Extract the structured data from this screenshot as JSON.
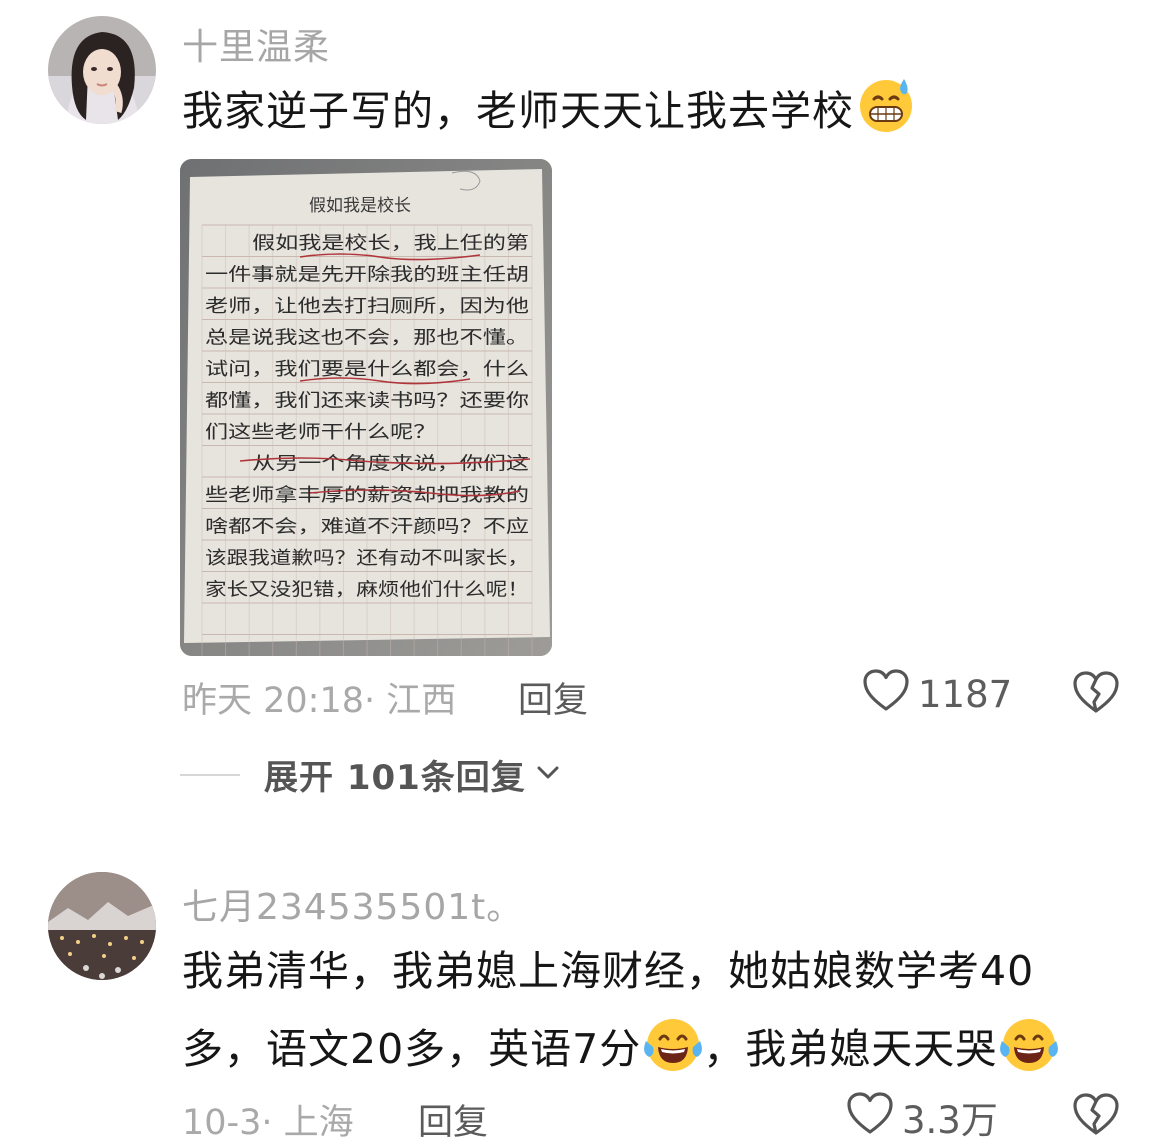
{
  "comments": [
    {
      "username": "十里温柔",
      "text": "我家逆子写的，老师天天让我去学校",
      "emoji_name": "grin-sweat-emoji",
      "photo": {
        "essay_title": "假如我是校长",
        "essay_lines": [
          "假如我是校长，我上任的第",
          "一件事就是先开除我的班主任胡",
          "老师，让他去打扫厕所，因为他",
          "总是说我这也不会，那也不懂。",
          "试问，我们要是什么都会，什么",
          "都懂，我们还来读书吗？还要你",
          "们这些老师干什么呢？",
          "从另一个角度来说，你们这",
          "些老师拿丰厚的薪资却把我教的",
          "啥都不会，难道不汗颜吗？不应",
          "该跟我道歉吗？还有动不叫家长，",
          "家长又没犯错，麻烦他们什么呢！"
        ]
      },
      "time_location": "昨天 20:18· 江西",
      "reply_label": "回复",
      "like_count": "1187",
      "expand_label": "展开 101条回复"
    },
    {
      "username": "七月234535501t。",
      "text_line1": "我弟清华，我弟媳上海财经，她姑娘数学考40",
      "text_line2a": "多，语文20多，英语7分",
      "text_line2b": "，我弟媳天天哭",
      "emoji_name": "tears-of-joy-emoji",
      "time_location": "10-3· 上海",
      "reply_label": "回复",
      "like_count": "3.3万"
    }
  ],
  "colors": {
    "meta": "#a9a9a9",
    "text": "#161616",
    "emoji_yellow": "#ffc93a",
    "ink_red": "#b0353a"
  }
}
